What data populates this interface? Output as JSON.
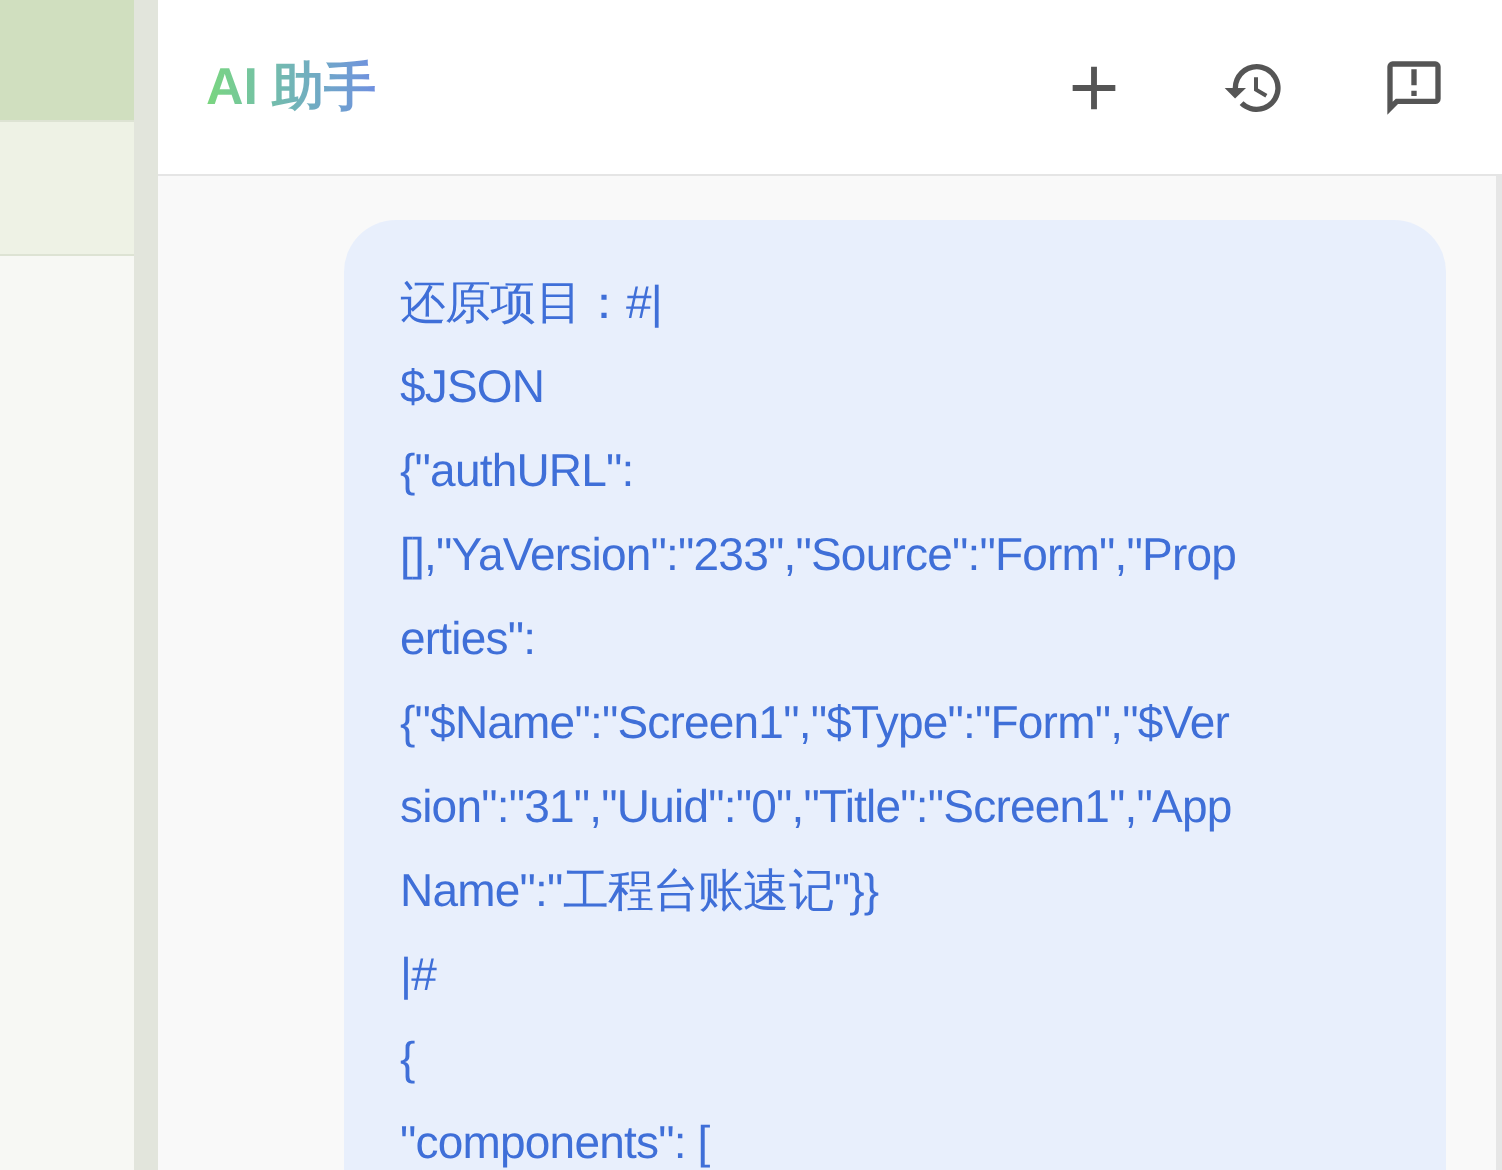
{
  "header": {
    "title": "AI 助手",
    "actions": [
      {
        "kind": "new"
      },
      {
        "kind": "history"
      },
      {
        "kind": "feedback"
      }
    ]
  },
  "message": {
    "lines": [
      "还原项目：#|",
      "$JSON",
      "{\"authURL\":",
      "[],\"YaVersion\":\"233\",\"Source\":\"Form\",\"Prop",
      "erties\":",
      "{\"$Name\":\"Screen1\",\"$Type\":\"Form\",\"$Ver",
      "sion\":\"31\",\"Uuid\":\"0\",\"Title\":\"Screen1\",\"App",
      "Name\":\"工程台账速记\"}}",
      "|#",
      "{",
      "\"components\": ["
    ]
  }
}
